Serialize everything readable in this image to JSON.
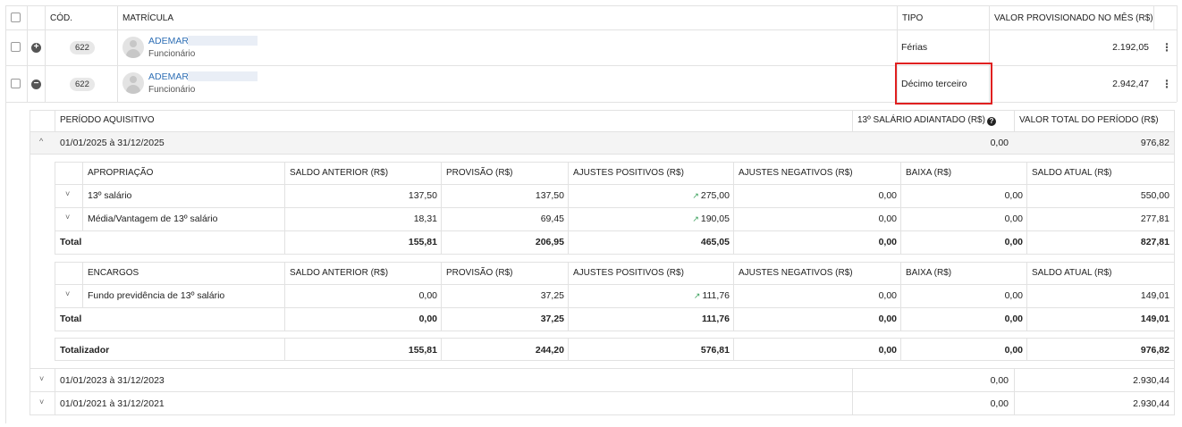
{
  "main_table": {
    "headers": {
      "code": "CÓD.",
      "matricula": "MATRÍCULA",
      "tipo": "TIPO",
      "valor": "VALOR PROVISIONADO NO MÊS (R$)"
    },
    "rows": [
      {
        "code": "622",
        "name": "ADEMAR",
        "role": "Funcionário",
        "tipo": "Férias",
        "valor": "2.192,05",
        "expand": "+"
      },
      {
        "code": "622",
        "name": "ADEMAR",
        "role": "Funcionário",
        "tipo": "Décimo terceiro",
        "valor": "2.942,47",
        "expand": "−"
      }
    ]
  },
  "periods_table": {
    "headers": {
      "periodo": "PERÍODO AQUISITIVO",
      "adiantado": "13º SALÁRIO ADIANTADO (R$)",
      "total": "VALOR TOTAL DO PERÍODO (R$)"
    },
    "periods": [
      {
        "label": "01/01/2025 à 31/12/2025",
        "adiantado": "0,00",
        "total": "976,82"
      },
      {
        "label": "01/01/2023 à 31/12/2023",
        "adiantado": "0,00",
        "total": "2.930,44"
      },
      {
        "label": "01/01/2021 à 31/12/2021",
        "adiantado": "0,00",
        "total": "2.930,44"
      }
    ]
  },
  "detail_headers": {
    "saldo_anterior": "SALDO ANTERIOR (R$)",
    "provisao": "PROVISÃO (R$)",
    "ajustes_positivos": "AJUSTES POSITIVOS (R$)",
    "ajustes_negativos": "AJUSTES NEGATIVOS (R$)",
    "baixa": "BAIXA (R$)",
    "saldo_atual": "SALDO ATUAL (R$)"
  },
  "apropriacao": {
    "title": "APROPRIAÇÃO",
    "rows": [
      {
        "label": "13º salário",
        "saldo_anterior": "137,50",
        "provisao": "137,50",
        "ajustes_positivos": "275,00",
        "ajustes_negativos": "0,00",
        "baixa": "0,00",
        "saldo_atual": "550,00"
      },
      {
        "label": "Média/Vantagem de 13º salário",
        "saldo_anterior": "18,31",
        "provisao": "69,45",
        "ajustes_positivos": "190,05",
        "ajustes_negativos": "0,00",
        "baixa": "0,00",
        "saldo_atual": "277,81"
      }
    ],
    "total": {
      "label": "Total",
      "saldo_anterior": "155,81",
      "provisao": "206,95",
      "ajustes_positivos": "465,05",
      "ajustes_negativos": "0,00",
      "baixa": "0,00",
      "saldo_atual": "827,81"
    }
  },
  "encargos": {
    "title": "ENCARGOS",
    "rows": [
      {
        "label": "Fundo previdência de 13º salário",
        "saldo_anterior": "0,00",
        "provisao": "37,25",
        "ajustes_positivos": "111,76",
        "ajustes_negativos": "0,00",
        "baixa": "0,00",
        "saldo_atual": "149,01"
      }
    ],
    "total": {
      "label": "Total",
      "saldo_anterior": "0,00",
      "provisao": "37,25",
      "ajustes_positivos": "111,76",
      "ajustes_negativos": "0,00",
      "baixa": "0,00",
      "saldo_atual": "149,01"
    }
  },
  "totalizador": {
    "label": "Totalizador",
    "saldo_anterior": "155,81",
    "provisao": "244,20",
    "ajustes_positivos": "576,81",
    "ajustes_negativos": "0,00",
    "baixa": "0,00",
    "saldo_atual": "976,82"
  },
  "icons": {
    "trend": "trend-up-icon",
    "kebab": "more-vertical-icon",
    "help": "help-circle-icon",
    "chevron": "chevron-icon"
  },
  "colors": {
    "link": "#2f6fb5",
    "highlight": "#e02020",
    "trend": "#3aa05c"
  }
}
